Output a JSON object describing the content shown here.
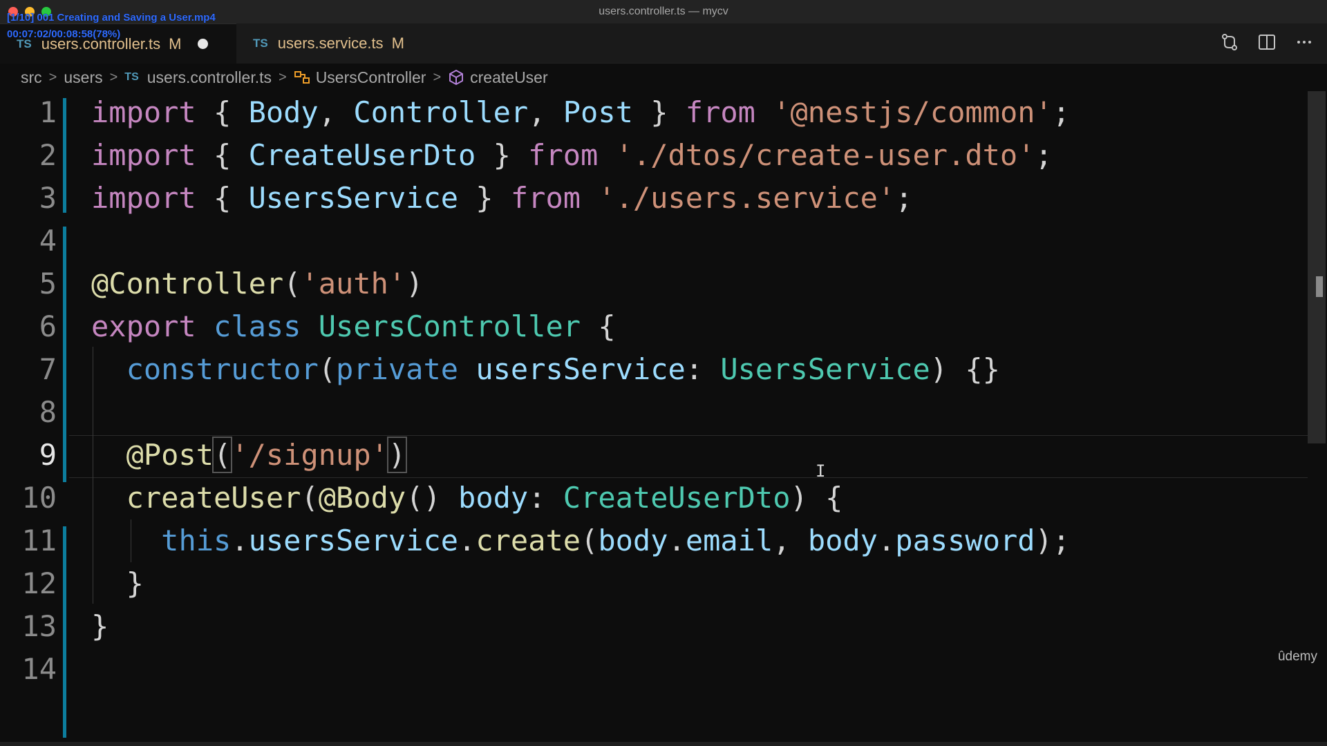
{
  "window": {
    "title": "users.controller.ts — mycv"
  },
  "overlay": {
    "video_title": "[1/10] 001 Creating and Saving a User.mp4",
    "timestamp": "00:07:02/00:08:58(78%)"
  },
  "tabs": [
    {
      "lang": "TS",
      "label": "users.controller.ts",
      "status": "M",
      "unsaved": true,
      "active": true
    },
    {
      "lang": "TS",
      "label": "users.service.ts",
      "status": "M",
      "unsaved": false,
      "active": false
    }
  ],
  "breadcrumb": {
    "items": [
      "src",
      "users",
      "users.controller.ts",
      "UsersController",
      "createUser"
    ],
    "file_lang": "TS"
  },
  "editor": {
    "active_line": 9,
    "line_numbers": [
      "1",
      "2",
      "3",
      "4",
      "5",
      "6",
      "7",
      "8",
      "9",
      "10",
      "11",
      "12",
      "13",
      "14"
    ]
  },
  "watermark": "ûdemy",
  "colors": {
    "keyword": "#c586c0",
    "storage": "#569cd6",
    "variable": "#9cdcfe",
    "type": "#4ec9b0",
    "string": "#ce9178",
    "function": "#dcdcaa",
    "gutter_modified": "#0c7d9d",
    "tab_modified": "#e2c08d"
  },
  "icons": [
    "source-control-icon",
    "split-editor-icon",
    "more-actions-icon",
    "class-icon",
    "method-icon"
  ]
}
